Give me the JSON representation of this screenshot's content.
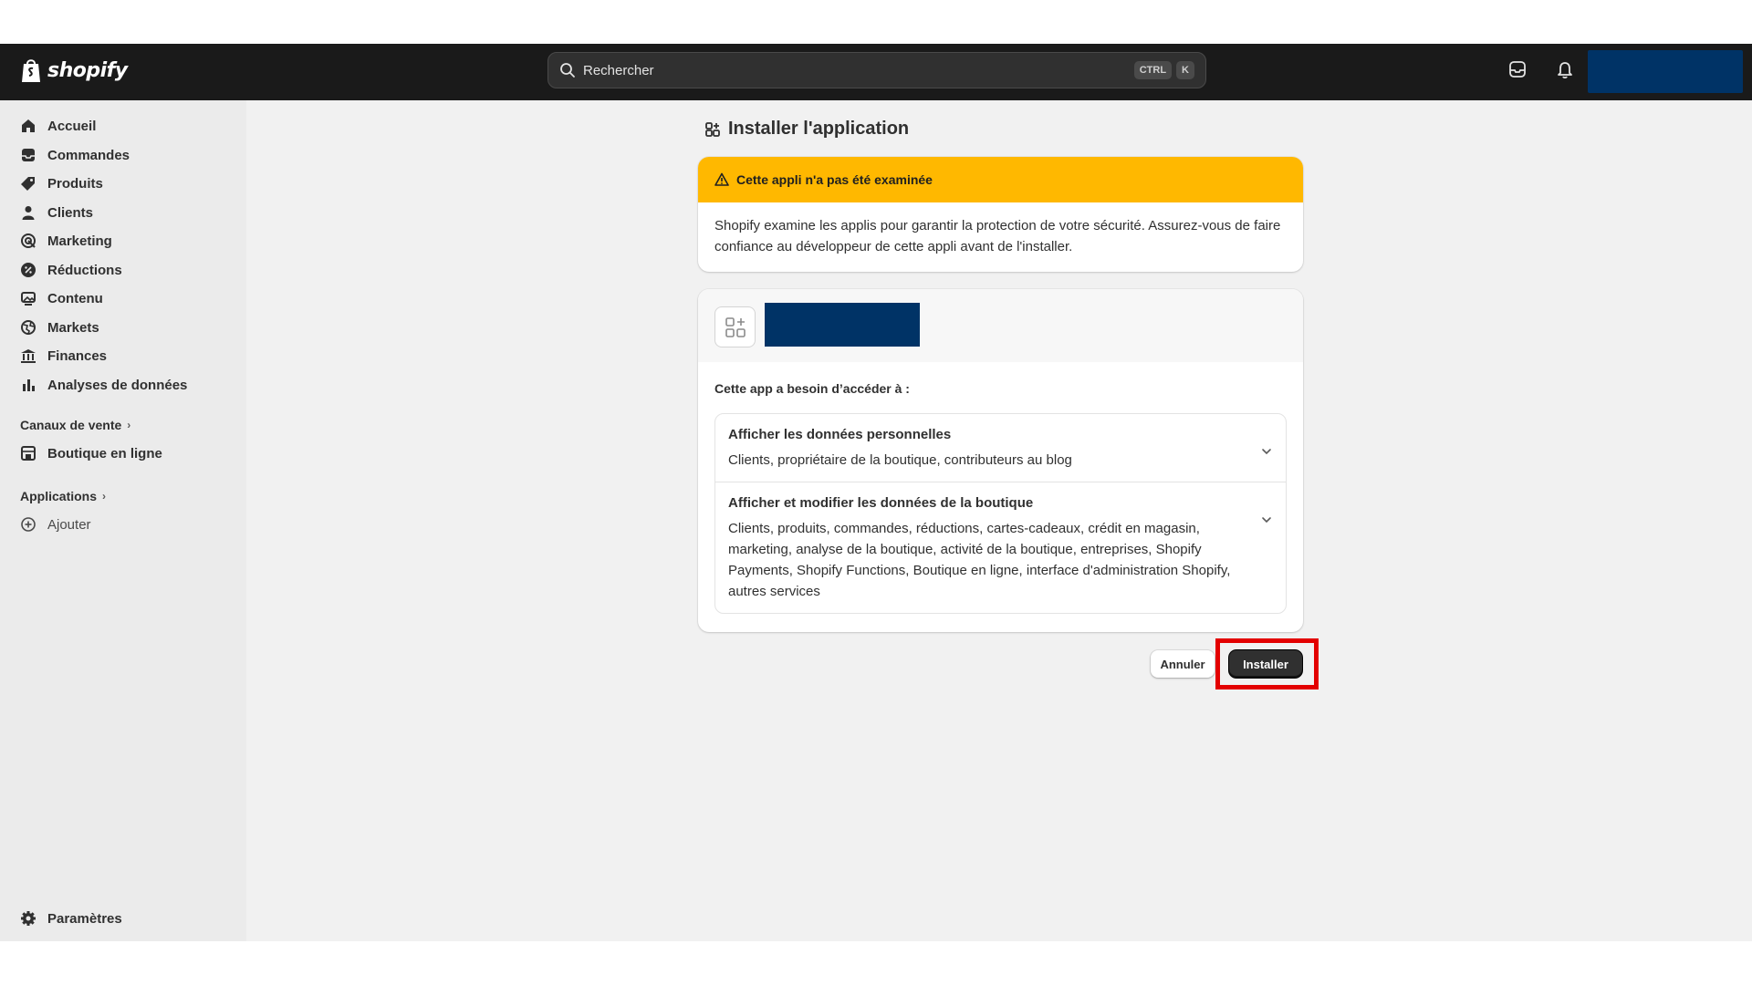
{
  "topbar": {
    "logo_text": "shopify",
    "search_placeholder": "Rechercher",
    "kbd_ctrl": "CTRL",
    "kbd_k": "K",
    "icons": [
      "inbox-icon",
      "bell-icon"
    ],
    "account_redacted": true,
    "bg_color": "#1a1a1a"
  },
  "sidebar": {
    "items": [
      {
        "label": "Accueil",
        "icon": "home-icon"
      },
      {
        "label": "Commandes",
        "icon": "inbox-icon"
      },
      {
        "label": "Produits",
        "icon": "tag-icon"
      },
      {
        "label": "Clients",
        "icon": "person-icon"
      },
      {
        "label": "Marketing",
        "icon": "target-icon"
      },
      {
        "label": "Réductions",
        "icon": "discount-icon"
      },
      {
        "label": "Contenu",
        "icon": "image-icon"
      },
      {
        "label": "Markets",
        "icon": "globe-icon"
      },
      {
        "label": "Finances",
        "icon": "bank-icon"
      },
      {
        "label": "Analyses de données",
        "icon": "bar-chart-icon"
      }
    ],
    "sales_channels_label": "Canaux de vente",
    "sales_channel_item": "Boutique en ligne",
    "apps_label": "Applications",
    "apps_add_label": "Ajouter",
    "settings_label": "Paramètres"
  },
  "page": {
    "title": "Installer l'application",
    "warning": {
      "title": "Cette appli n'a pas été examinée",
      "body": "Shopify examine les applis pour garantir la protection de votre sécurité. Assurez-vous de faire confiance au développeur de cette appli avant de l'installer.",
      "color": "#ffb800"
    },
    "permissions": {
      "intro": "Cette app a besoin d’accéder à :",
      "rows": [
        {
          "title": "Afficher les données personnelles",
          "desc": "Clients, propriétaire de la boutique, contributeurs au blog"
        },
        {
          "title": "Afficher et modifier les données de la boutique",
          "desc": "Clients, produits, commandes, réductions, cartes-cadeaux, crédit en magasin, marketing, analyse de la boutique, activité de la boutique, entreprises, Shopify Payments, Shopify Functions, Boutique en ligne, interface d'administration Shopify, autres services"
        }
      ]
    },
    "cancel_label": "Annuler",
    "install_label": "Installer",
    "highlight_color": "#e30000"
  }
}
